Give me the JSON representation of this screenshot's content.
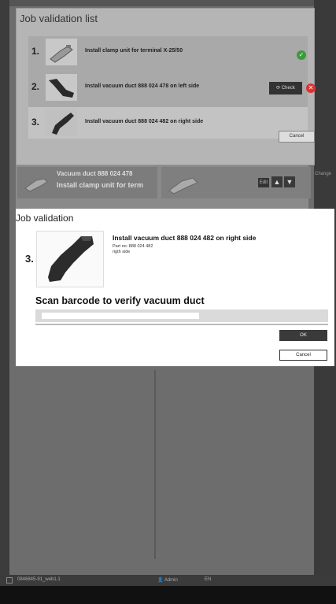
{
  "list_dialog": {
    "title": "Job validation list",
    "items": [
      {
        "number": "1.",
        "text": "Install clamp unit for terminal X-25/50",
        "status": "ok"
      },
      {
        "number": "2.",
        "text": "Install vacuum duct  888 024 478 on left side",
        "status": "error",
        "action_label": "Check"
      },
      {
        "number": "3.",
        "text": "Install vacuum duct  888 024 482 on right side",
        "status": "selected"
      }
    ],
    "cancel_label": "Cancel"
  },
  "background": {
    "row_title": "Install clamp unit for term",
    "row_sub": "Vacuum duct  888 024 478",
    "edit_label": "Edit",
    "side_label": "Change"
  },
  "validation_dialog": {
    "title": "Job validation",
    "number": "3.",
    "heading": "Install vacuum duct  888 024 482 on right side",
    "part_no": "Part no: 888 024 482",
    "side": "rigth side",
    "scan_text": "Scan barcode to verify vacuum duct",
    "scan_value": "",
    "ok_label": "OK",
    "cancel_label": "Cancel"
  },
  "status_bar": {
    "path": "0846845-91_web1.1",
    "user": "Admin",
    "language": "EN"
  },
  "colors": {
    "ok": "#3c9a3c",
    "error": "#d33333",
    "dark_button": "#333333"
  }
}
